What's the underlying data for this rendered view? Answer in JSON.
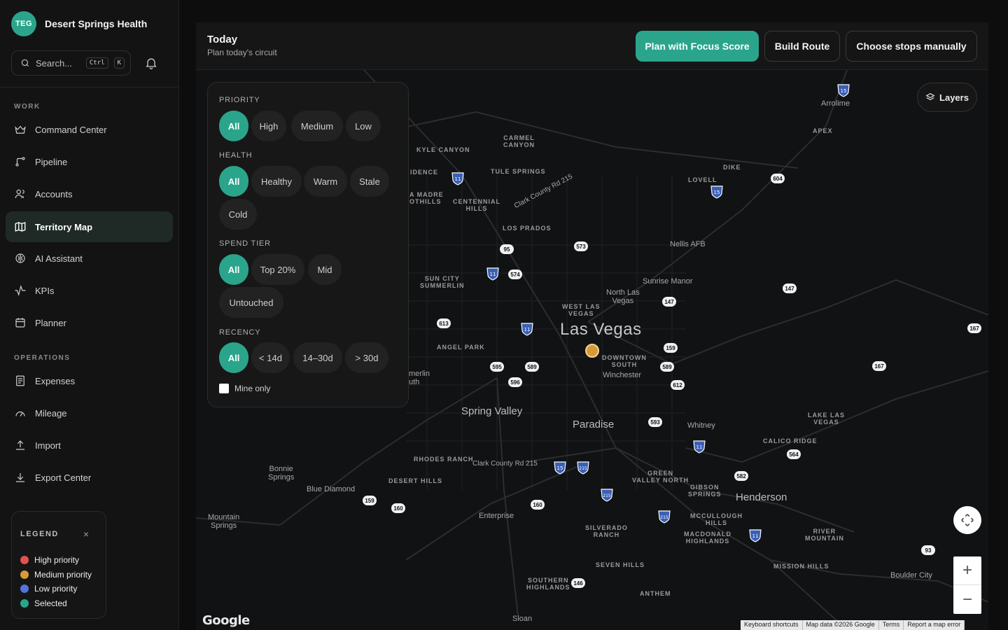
{
  "brand": {
    "logo_text": "TEG",
    "name": "Desert Springs Health"
  },
  "search": {
    "placeholder": "Search...",
    "kbd1": "Ctrl",
    "kbd2": "K"
  },
  "nav": {
    "work_label": "WORK",
    "work_items": [
      {
        "label": "Command Center",
        "icon": "crown-icon"
      },
      {
        "label": "Pipeline",
        "icon": "pipeline-icon"
      },
      {
        "label": "Accounts",
        "icon": "users-icon"
      },
      {
        "label": "Territory Map",
        "icon": "map-icon",
        "active": true
      },
      {
        "label": "AI Assistant",
        "icon": "brain-icon"
      },
      {
        "label": "KPIs",
        "icon": "pulse-icon"
      },
      {
        "label": "Planner",
        "icon": "calendar-icon"
      }
    ],
    "ops_label": "OPERATIONS",
    "ops_items": [
      {
        "label": "Expenses",
        "icon": "receipt-icon"
      },
      {
        "label": "Mileage",
        "icon": "gauge-icon"
      },
      {
        "label": "Import",
        "icon": "upload-icon"
      },
      {
        "label": "Export Center",
        "icon": "download-icon"
      }
    ]
  },
  "legend": {
    "title": "LEGEND",
    "close": "×",
    "items": [
      {
        "label": "High priority",
        "color": "#e0524f"
      },
      {
        "label": "Medium priority",
        "color": "#d69a35"
      },
      {
        "label": "Low priority",
        "color": "#5273e0"
      },
      {
        "label": "Selected",
        "color": "#2aa58c"
      }
    ]
  },
  "topbar": {
    "title": "Today",
    "subtitle": "Plan today's circuit",
    "btn_focus": "Plan with Focus Score",
    "btn_route": "Build Route",
    "btn_manual": "Choose stops manually"
  },
  "filters": {
    "priority": {
      "label": "PRIORITY",
      "options": [
        "All",
        "High",
        "Medium",
        "Low"
      ],
      "selected": "All"
    },
    "health": {
      "label": "HEALTH",
      "options": [
        "All",
        "Healthy",
        "Warm",
        "Stale",
        "Cold"
      ],
      "selected": "All"
    },
    "spend": {
      "label": "SPEND TIER",
      "options": [
        "All",
        "Top 20%",
        "Mid",
        "Untouched"
      ],
      "selected": "All"
    },
    "recency": {
      "label": "RECENCY",
      "options": [
        "All",
        "< 14d",
        "14–30d",
        "> 30d"
      ],
      "selected": "All"
    },
    "mine_only": "Mine only"
  },
  "map": {
    "layers": "Layers",
    "google": "Google",
    "attribution": [
      "Keyboard shortcuts",
      "Map data ©2026 Google",
      "Terms",
      "Report a map error"
    ],
    "labels": {
      "las_vegas": "Las Vegas",
      "spring_valley": "Spring Valley",
      "paradise": "Paradise",
      "henderson": "Henderson",
      "winchester": "Winchester",
      "enterprise": "Enterprise",
      "whitney": "Whitney",
      "nellis": "Nellis AFB",
      "sunrise": "Sunrise Manor",
      "north_lv": "North Las\nVegas",
      "arrolime": "Arrolime",
      "bonnie": "Bonnie\nSprings",
      "blue_diamond": "Blue Diamond",
      "mountain": "Mountain\nSprings",
      "boulder": "Boulder City",
      "sloan": "Sloan",
      "merlin": "merlin\nuth",
      "carmel": "CARMEL\nCANYON",
      "kyle": "KYLE CANYON",
      "tule": "TULE SPRINGS",
      "dike": "DIKE",
      "lovell": "LOVELL",
      "apex": "APEX",
      "idence": "IDENCE",
      "madre": "A MADRE\nOTHILLS",
      "centennial": "CENTENNIAL\nHILLS",
      "los_prados": "LOS PRADOS",
      "sun_city": "SUN CITY\nSUMMERLIN",
      "west_lv": "WEST LAS\nVEGAS",
      "angel": "ANGEL PARK",
      "downtown": "DOWNTOWN\nSOUTH",
      "lake_lv": "LAKE LAS\nVEGAS",
      "calico": "CALICO RIDGE",
      "rhodes": "RHODES RANCH",
      "desert_hills": "DESERT HILLS",
      "green_valley": "GREEN\nVALLEY NORTH",
      "gibson": "GIBSON\nSPRINGS",
      "mccullough": "MCCULLOUGH\nHILLS",
      "macdonald": "MACDONALD\nHIGHLANDS",
      "river_mtn": "RIVER\nMOUNTAIN",
      "mission": "MISSION HILLS",
      "silverado": "SILVERADO\nRANCH",
      "seven_hills": "SEVEN HILLS",
      "southern": "SOUTHERN\nHIGHLANDS",
      "anthem": "ANTHEM",
      "clark_215": "Clark County Rd 215",
      "clark_215b": "Clark County Rd 215",
      "rd215": "Rd 215"
    },
    "routes": [
      "15",
      "11",
      "95",
      "573",
      "574",
      "613",
      "595",
      "589",
      "596",
      "147",
      "159",
      "612",
      "593",
      "167",
      "604",
      "564",
      "582",
      "160",
      "146",
      "215",
      "93"
    ]
  }
}
